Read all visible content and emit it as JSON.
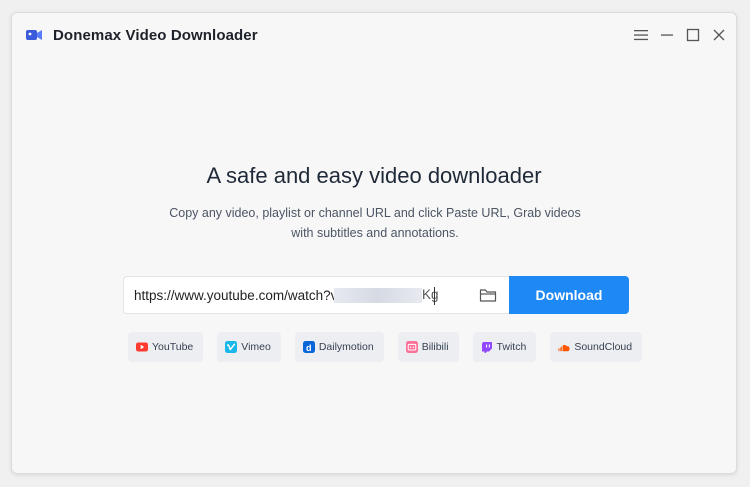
{
  "app": {
    "title": "Donemax Video Downloader",
    "brand_color": "#3b5bdb"
  },
  "window_controls": [
    "menu-icon",
    "minimize-icon",
    "maximize-icon",
    "close-icon"
  ],
  "main": {
    "headline": "A safe and easy video downloader",
    "subtext": "Copy any video, playlist or channel URL and click Paste URL, Grab videos with subtitles and annotations."
  },
  "search": {
    "url_value": "https://www.youtube.com/watch?v=",
    "url_suffix": "Kg",
    "folder_icon": "folder-icon",
    "download_label": "Download",
    "accent_color": "#1e88f5"
  },
  "platforms": [
    {
      "label": "YouTube",
      "icon": "youtube-icon",
      "color": "#ff3b30"
    },
    {
      "label": "Vimeo",
      "icon": "vimeo-icon",
      "color": "#1ab7ea"
    },
    {
      "label": "Dailymotion",
      "icon": "dailymotion-icon",
      "color": "#0a66d8"
    },
    {
      "label": "Bilibili",
      "icon": "bilibili-icon",
      "color": "#fb7299"
    },
    {
      "label": "Twitch",
      "icon": "twitch-icon",
      "color": "#9146ff"
    },
    {
      "label": "SoundCloud",
      "icon": "soundcloud-icon",
      "color": "#ff5500"
    }
  ]
}
